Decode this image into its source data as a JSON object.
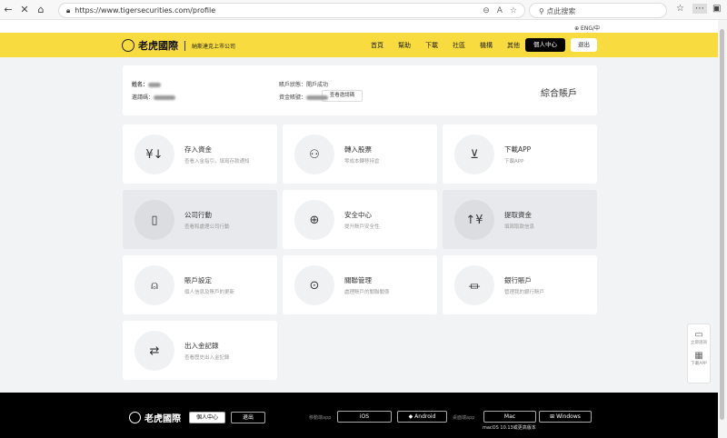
{
  "browser": {
    "url": "https://www.tigersecurities.com/profile",
    "search_placeholder": "点此搜索"
  },
  "lang": "ENG/中",
  "header": {
    "brand": "老虎國際",
    "tagline": "納斯達克上市公司",
    "nav": [
      "首頁",
      "幫助",
      "下載",
      "社區",
      "機構",
      "其他"
    ],
    "personal_center": "個人中心",
    "logout": "退出"
  },
  "info": {
    "name_label": "姓名：",
    "invite_label": "邀請碼：",
    "view_invite": "查看邀請碼",
    "status_label": "賬戶狀態：",
    "status_value": "開戶成功",
    "fund_label": "資金賬號：",
    "account_type": "綜合賬戶"
  },
  "cards": [
    {
      "title": "存入資金",
      "desc": "查看入金指引，填寫存款通知",
      "icon": "deposit-icon"
    },
    {
      "title": "轉入股票",
      "desc": "零成本轉移持倉",
      "icon": "transfer-stock-icon"
    },
    {
      "title": "下載APP",
      "desc": "下載APP",
      "icon": "download-icon"
    },
    {
      "title": "公司行動",
      "desc": "查看和處理公司行動",
      "icon": "building-icon"
    },
    {
      "title": "安全中心",
      "desc": "提升賬戶安全性",
      "icon": "shield-icon"
    },
    {
      "title": "提取資金",
      "desc": "填寫取款信息",
      "icon": "withdraw-icon"
    },
    {
      "title": "賬戶設定",
      "desc": "個人信息及賬戶的更新",
      "icon": "user-icon"
    },
    {
      "title": "關聯管理",
      "desc": "處理賬戶的關聯關係",
      "icon": "link-icon"
    },
    {
      "title": "銀行賬戶",
      "desc": "管理我的銀行賬戶",
      "icon": "bank-icon"
    },
    {
      "title": "出入金記錄",
      "desc": "查看歷史出入金記錄",
      "icon": "record-icon"
    }
  ],
  "side": {
    "consult": "立即諮詢",
    "download": "下載APP"
  },
  "footer": {
    "brand": "老虎國際",
    "personal_center": "個人中心",
    "logout": "退出",
    "mobile_label": "移動端app",
    "ios": "iOS",
    "android": "Android",
    "desktop_label": "桌面端app",
    "mac": "Mac",
    "windows": "Windows",
    "mac_note": "macOS 10.13或更高版本"
  }
}
